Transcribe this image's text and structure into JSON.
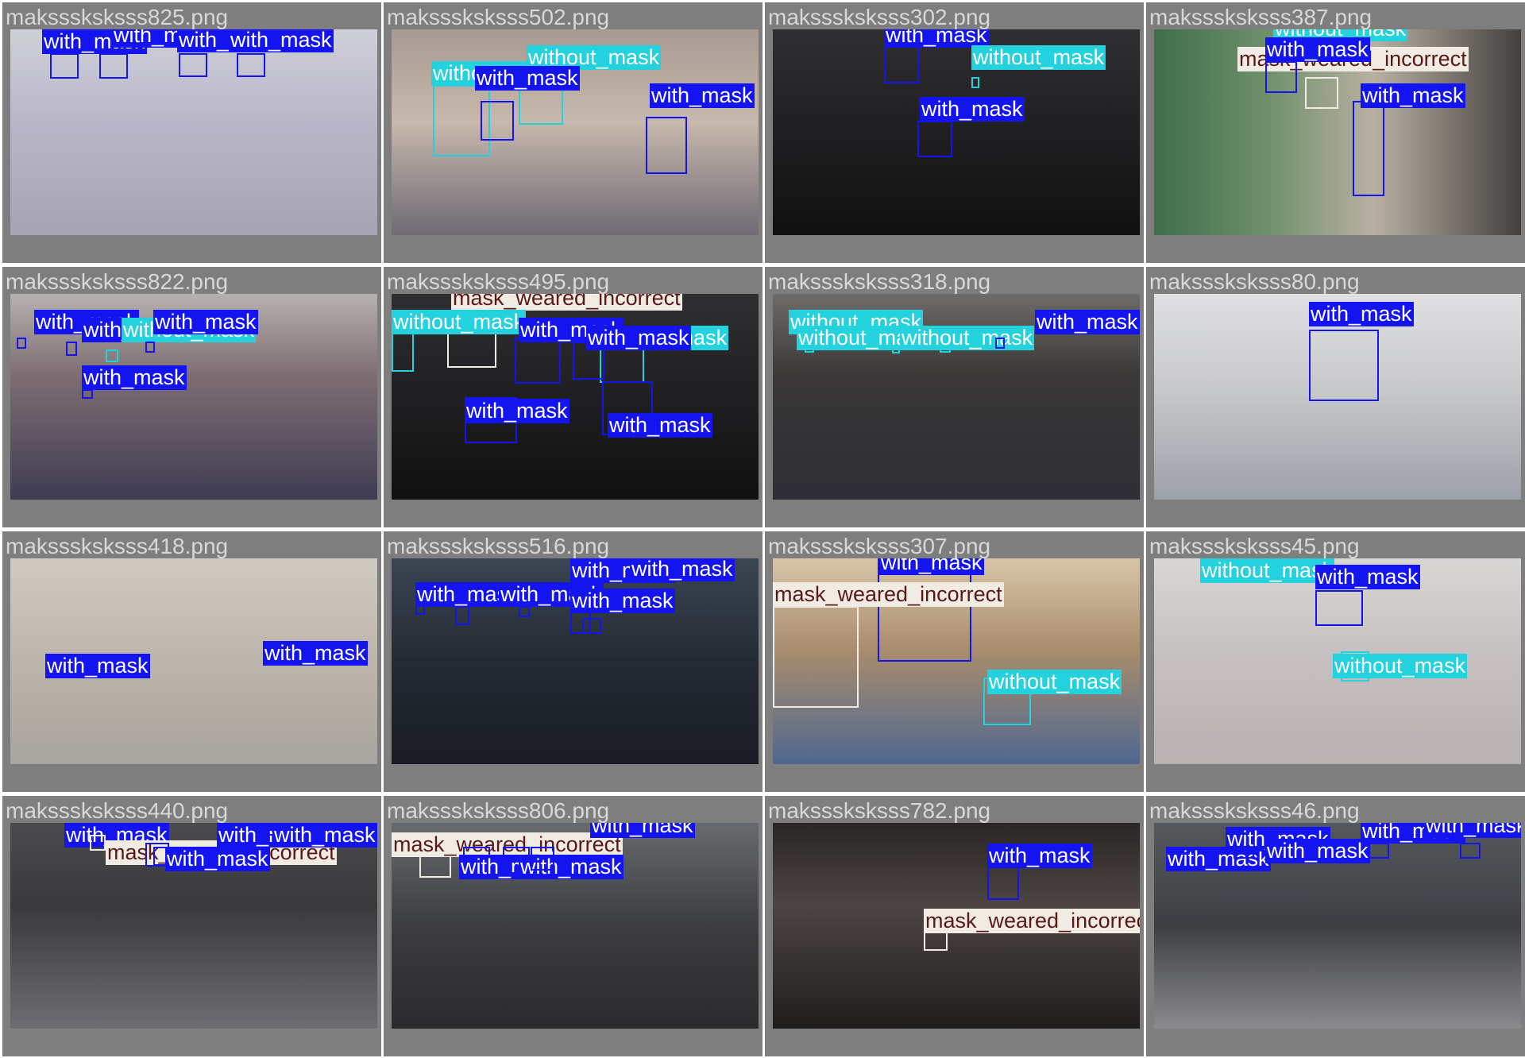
{
  "colors": {
    "with_mask": "#1414f0",
    "without_mask": "#23d2dc",
    "mask_weared_incorrect": "#f0ece4",
    "tile_background": "#7e7e7e",
    "filename_text": "#d8d8d8"
  },
  "tiles": [
    {
      "filename": "maksssksksss825.png",
      "scene": "purple",
      "labels": [
        {
          "cls": "with_mask",
          "text": "with_mask"
        },
        {
          "cls": "with_mask",
          "text": "with_mask"
        },
        {
          "cls": "with_mask",
          "text": "with_mask"
        },
        {
          "cls": "with_mask",
          "text": "with_mask"
        }
      ]
    },
    {
      "filename": "maksssksksss502.png",
      "scene": "news",
      "labels": [
        {
          "cls": "without_mask",
          "text": "without_mask"
        },
        {
          "cls": "without_mask",
          "text": "without_mask"
        },
        {
          "cls": "with_mask",
          "text": "with_mask"
        },
        {
          "cls": "with_mask",
          "text": "with_mask"
        }
      ]
    },
    {
      "filename": "maksssksksss302.png",
      "scene": "dark",
      "labels": [
        {
          "cls": "with_mask",
          "text": "with_mask"
        },
        {
          "cls": "without_mask",
          "text": "without_mask"
        },
        {
          "cls": "with_mask",
          "text": "with_mask"
        }
      ]
    },
    {
      "filename": "maksssksksss387.png",
      "scene": "market",
      "labels": [
        {
          "cls": "without_mask",
          "text": "without_mask"
        },
        {
          "cls": "mask_weared_incorrect",
          "text": "mask_weared_incorrect"
        },
        {
          "cls": "with_mask",
          "text": "with_mask"
        },
        {
          "cls": "with_mask",
          "text": "with_mask"
        }
      ]
    },
    {
      "filename": "maksssksksss822.png",
      "scene": "crowd",
      "labels": [
        {
          "cls": "with_mask",
          "text": "with_mask"
        },
        {
          "cls": "with_mask",
          "text": "with_mask"
        },
        {
          "cls": "without_mask",
          "text": "without_mask"
        },
        {
          "cls": "with_mask",
          "text": "with_mask"
        },
        {
          "cls": "with_mask",
          "text": "with_mask"
        }
      ]
    },
    {
      "filename": "maksssksksss495.png",
      "scene": "dark",
      "labels": [
        {
          "cls": "mask_weared_incorrect",
          "text": "mask_weared_incorrect"
        },
        {
          "cls": "without_mask",
          "text": "without_mask"
        },
        {
          "cls": "with_mask",
          "text": "with_mask"
        },
        {
          "cls": "without_mask",
          "text": "without_mask"
        },
        {
          "cls": "with_mask",
          "text": "with_mask"
        },
        {
          "cls": "with_mask",
          "text": "with_mask"
        },
        {
          "cls": "with_mask",
          "text": "with_mask"
        }
      ]
    },
    {
      "filename": "maksssksksss318.png",
      "scene": "airport",
      "labels": [
        {
          "cls": "without_mask",
          "text": "without_mask"
        },
        {
          "cls": "without_mask",
          "text": "without_mask"
        },
        {
          "cls": "without_mask",
          "text": "without_mask"
        },
        {
          "cls": "with_mask",
          "text": "with_mask"
        }
      ]
    },
    {
      "filename": "maksssksksss80.png",
      "scene": "street",
      "labels": [
        {
          "cls": "with_mask",
          "text": "with_mask"
        }
      ]
    },
    {
      "filename": "maksssksksss418.png",
      "scene": "station",
      "labels": [
        {
          "cls": "with_mask",
          "text": "with_mask"
        },
        {
          "cls": "with_mask",
          "text": "with_mask"
        }
      ]
    },
    {
      "filename": "maksssksksss516.png",
      "scene": "hall",
      "labels": [
        {
          "cls": "with_mask",
          "text": "with_mask"
        },
        {
          "cls": "with_mask",
          "text": "with_mask"
        },
        {
          "cls": "with_mask",
          "text": "with_mask"
        },
        {
          "cls": "with_mask",
          "text": "with_mask"
        },
        {
          "cls": "with_mask",
          "text": "with_mask"
        }
      ]
    },
    {
      "filename": "maksssksksss307.png",
      "scene": "closeup",
      "labels": [
        {
          "cls": "with_mask",
          "text": "with_mask"
        },
        {
          "cls": "mask_weared_incorrect",
          "text": "mask_weared_incorrect"
        },
        {
          "cls": "without_mask",
          "text": "without_mask"
        }
      ]
    },
    {
      "filename": "maksssksksss45.png",
      "scene": "blurred",
      "labels": [
        {
          "cls": "without_mask",
          "text": "without_mask"
        },
        {
          "cls": "with_mask",
          "text": "with_mask"
        },
        {
          "cls": "without_mask",
          "text": "without_mask"
        }
      ]
    },
    {
      "filename": "maksssksksss440.png",
      "scene": "luggage",
      "labels": [
        {
          "cls": "with_mask",
          "text": "with_mask"
        },
        {
          "cls": "mask_weared_incorrect",
          "text": "mask_weared_incorrect"
        },
        {
          "cls": "with_mask",
          "text": "with_mask"
        },
        {
          "cls": "with_mask",
          "text": "with_mask"
        },
        {
          "cls": "with_mask",
          "text": "with_mask"
        }
      ]
    },
    {
      "filename": "maksssksksss806.png",
      "scene": "protest",
      "labels": [
        {
          "cls": "mask_weared_incorrect",
          "text": "mask_weared_incorrect"
        },
        {
          "cls": "with_mask",
          "text": "with_mask"
        },
        {
          "cls": "with_mask",
          "text": "with_mask"
        },
        {
          "cls": "with_mask",
          "text": "with_mask"
        }
      ]
    },
    {
      "filename": "maksssksksss782.png",
      "scene": "alley",
      "labels": [
        {
          "cls": "with_mask",
          "text": "with_mask"
        },
        {
          "cls": "mask_weared_incorrect",
          "text": "mask_weared_incorrect"
        }
      ]
    },
    {
      "filename": "maksssksksss46.png",
      "scene": "terminal",
      "labels": [
        {
          "cls": "with_mask",
          "text": "with_mask"
        },
        {
          "cls": "with_mask",
          "text": "with_mask"
        },
        {
          "cls": "with_mask",
          "text": "with_mask"
        },
        {
          "cls": "with_mask",
          "text": "with_mask"
        },
        {
          "cls": "with_mask",
          "text": "with_mask"
        }
      ]
    }
  ]
}
